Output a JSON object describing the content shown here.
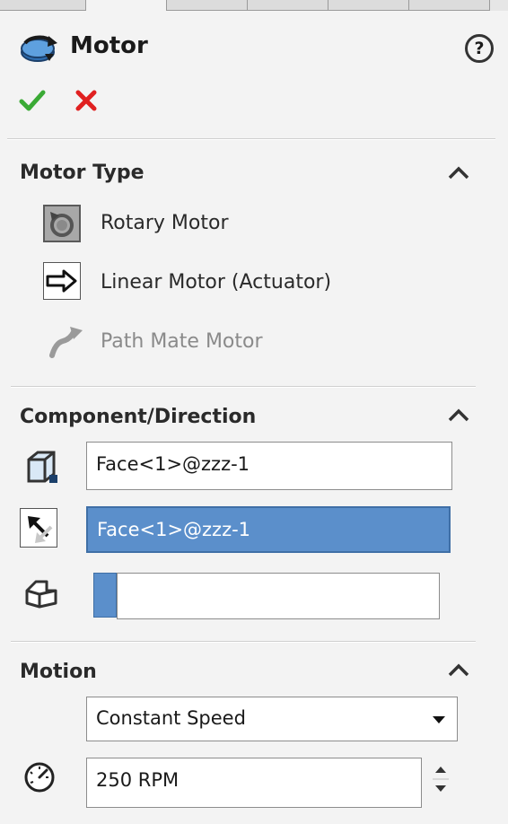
{
  "window": {
    "title": "Motor",
    "help_glyph": "?"
  },
  "motor_type": {
    "title": "Motor Type",
    "options": [
      {
        "label": "Rotary Motor",
        "selected": true
      },
      {
        "label": "Linear Motor (Actuator)",
        "selected": false
      },
      {
        "label": "Path Mate Motor",
        "enabled": false
      }
    ]
  },
  "component_direction": {
    "title": "Component/Direction",
    "location_value": "Face<1>@zzz-1",
    "direction_value": "Face<1>@zzz-1",
    "relative_component_value": ""
  },
  "motion": {
    "title": "Motion",
    "motion_type": "Constant Speed",
    "speed_value": "250 RPM"
  },
  "colors": {
    "accept": "#3aaa35",
    "cancel": "#e02020",
    "selection": "#5b8fcb"
  }
}
